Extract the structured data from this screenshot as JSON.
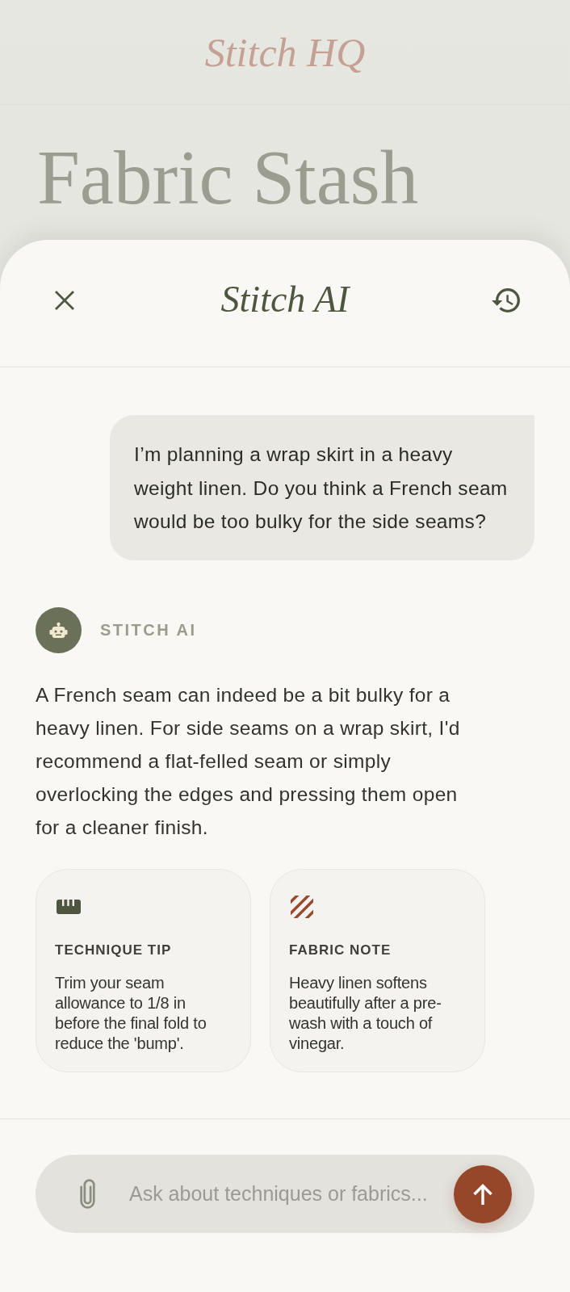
{
  "background_page": {
    "brand": "Stitch HQ",
    "title": "Fabric Stash"
  },
  "sheet": {
    "title": "Stitch AI"
  },
  "messages": [
    {
      "kind": "user",
      "text": "I’m planning a wrap skirt in a heavy weight linen. Do you think a French seam would be too bulky for the side seams?"
    },
    {
      "kind": "assistant",
      "sender": "STITCH AI",
      "text": "A French seam can indeed be a bit bulky for a heavy linen. For side seams on a wrap skirt, I'd recommend a flat-felled seam or simply overlocking the edges and pressing them open for a cleaner finish.",
      "cards": [
        {
          "kind": "technique",
          "heading": "TECHNIQUE TIP",
          "body": "Trim your seam allowance to 1/8 in before the final fold to reduce the 'bump'."
        },
        {
          "kind": "fabric",
          "heading": "FABRIC NOTE",
          "body": "Heavy linen softens beautifully after a pre-wash with a touch of vinegar."
        }
      ]
    }
  ],
  "composer": {
    "placeholder": "Ask about techniques or fabrics..."
  }
}
